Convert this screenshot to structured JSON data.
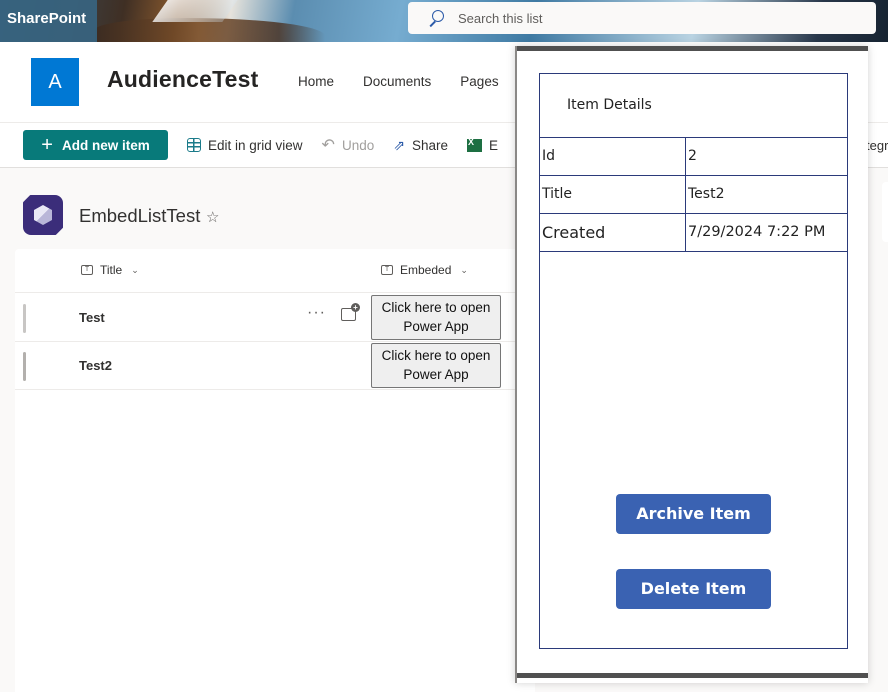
{
  "suite": {
    "brand": "SharePoint",
    "search_placeholder": "Search this list"
  },
  "site": {
    "logo_letter": "A",
    "title": "AudienceTest",
    "nav": [
      "Home",
      "Documents",
      "Pages"
    ]
  },
  "commands": {
    "add_new_item": "Add new item",
    "edit_grid": "Edit in grid view",
    "undo": "Undo",
    "share": "Share",
    "export_truncated": "E",
    "integrate_truncated": "tegr"
  },
  "list": {
    "title": "EmbedListTest",
    "columns": [
      "Title",
      "Embeded"
    ],
    "rows": [
      {
        "title": "Test",
        "embed_button": "Click here to open Power App"
      },
      {
        "title": "Test2",
        "embed_button": "Click here to open Power App"
      }
    ]
  },
  "panel": {
    "header": "Item Details",
    "fields": [
      {
        "label": "Id",
        "value": "2"
      },
      {
        "label": "Title",
        "value": "Test2"
      },
      {
        "label": "Created",
        "value": "7/29/2024 7:22 PM"
      }
    ],
    "archive_button": "Archive Item",
    "delete_button": "Delete Item",
    "accent_color": "#3a62b2",
    "border_color": "#2b3a7a"
  },
  "colors": {
    "brand_teal": "#087a7a",
    "site_logo": "#0078d4",
    "list_icon": "#3b2d7a"
  }
}
